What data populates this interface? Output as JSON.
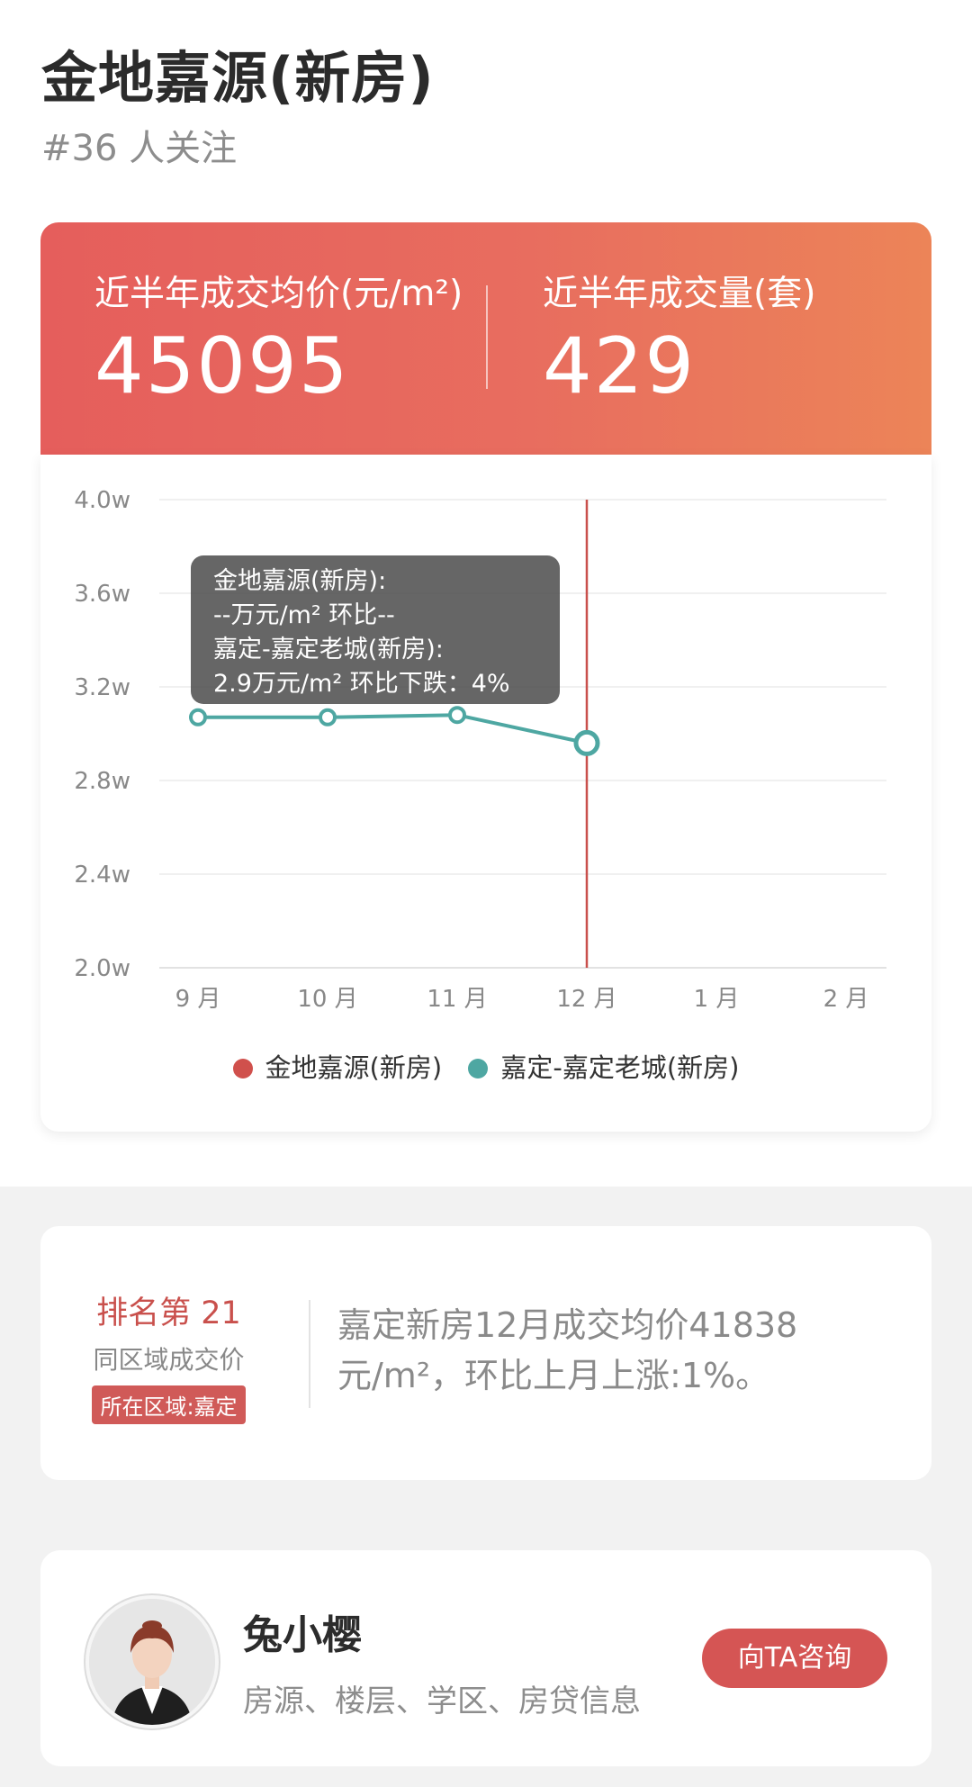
{
  "header": {
    "title": "金地嘉源(新房)",
    "followers": "#36 人关注"
  },
  "summary": {
    "avg_price_label": "近半年成交均价(元/m²)",
    "avg_price_value": "45095",
    "volume_label": "近半年成交量(套)",
    "volume_value": "429"
  },
  "tooltip": {
    "line1": "金地嘉源(新房):",
    "line2": "--万元/m² 环比--",
    "line3": "嘉定-嘉定老城(新房):",
    "line4": "2.9万元/m² 环比下跌：4%"
  },
  "chart_data": {
    "type": "line",
    "categories": [
      "9 月",
      "10 月",
      "11 月",
      "12 月",
      "1 月",
      "2 月"
    ],
    "y_ticks": [
      "4.0w",
      "3.6w",
      "3.2w",
      "2.8w",
      "2.4w",
      "2.0w"
    ],
    "ylim": [
      2.0,
      4.0
    ],
    "y_unit": "w",
    "series": [
      {
        "name": "金地嘉源(新房)",
        "color": "#d0504c",
        "values": [
          null,
          null,
          null,
          null,
          null,
          null
        ]
      },
      {
        "name": "嘉定-嘉定老城(新房)",
        "color": "#4ea7a2",
        "values": [
          3.07,
          3.07,
          3.08,
          2.96,
          null,
          null
        ]
      }
    ],
    "highlight_index": 3,
    "grid": true,
    "legend_position": "bottom"
  },
  "ranking": {
    "title": "排名第 21",
    "subtitle": "同区域成交价",
    "badge": "所在区域:嘉定",
    "description": "嘉定新房12月成交均价41838元/m²，环比上月上涨:1%。"
  },
  "agent": {
    "name": "兔小樱",
    "description": "房源、楼层、学区、房贷信息",
    "consult_label": "向TA咨询"
  },
  "colors": {
    "accent_red": "#d55554",
    "teal": "#4ea7a2",
    "gradient_start": "#e55e5c",
    "gradient_end": "#ec8458"
  }
}
